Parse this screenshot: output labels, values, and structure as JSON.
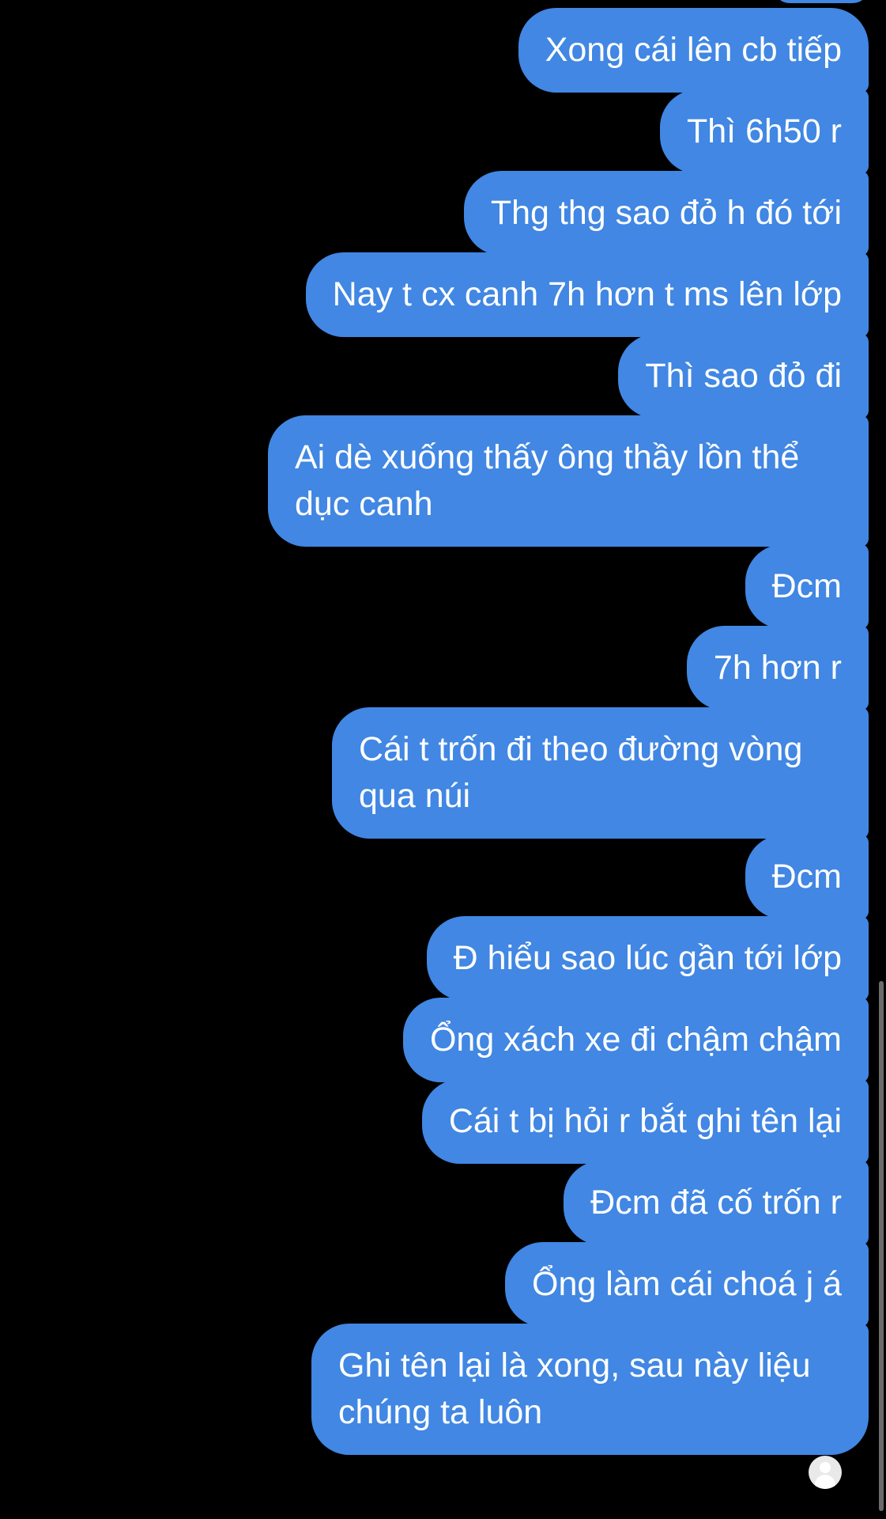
{
  "messages": [
    {
      "text": "Xong cái lên cb tiếp"
    },
    {
      "text": "Thì 6h50 r"
    },
    {
      "text": "Thg thg sao đỏ h đó tới"
    },
    {
      "text": "Nay t cx canh 7h hơn t ms lên lớp"
    },
    {
      "text": "Thì sao đỏ đi"
    },
    {
      "text": "Ai dè xuống thấy ông thầy lồn thể dục canh"
    },
    {
      "text": "Đcm"
    },
    {
      "text": "7h hơn r"
    },
    {
      "text": "Cái t trốn đi theo đường vòng qua núi"
    },
    {
      "text": "Đcm"
    },
    {
      "text": "Đ hiểu sao lúc gần tới lớp"
    },
    {
      "text": "Ổng xách xe đi chậm chậm"
    },
    {
      "text": "Cái t bị hỏi r bắt ghi tên lại"
    },
    {
      "text": "Đcm đã cố trốn r"
    },
    {
      "text": "Ổng làm cái choá j á"
    },
    {
      "text": "Ghi tên lại là xong, sau này liệu chúng ta luôn"
    }
  ],
  "colors": {
    "background": "#000000",
    "outgoing_bubble": "#4187E3",
    "bubble_text": "#FFFFFF"
  },
  "icons": {
    "read_receipt": "user-avatar-icon"
  }
}
